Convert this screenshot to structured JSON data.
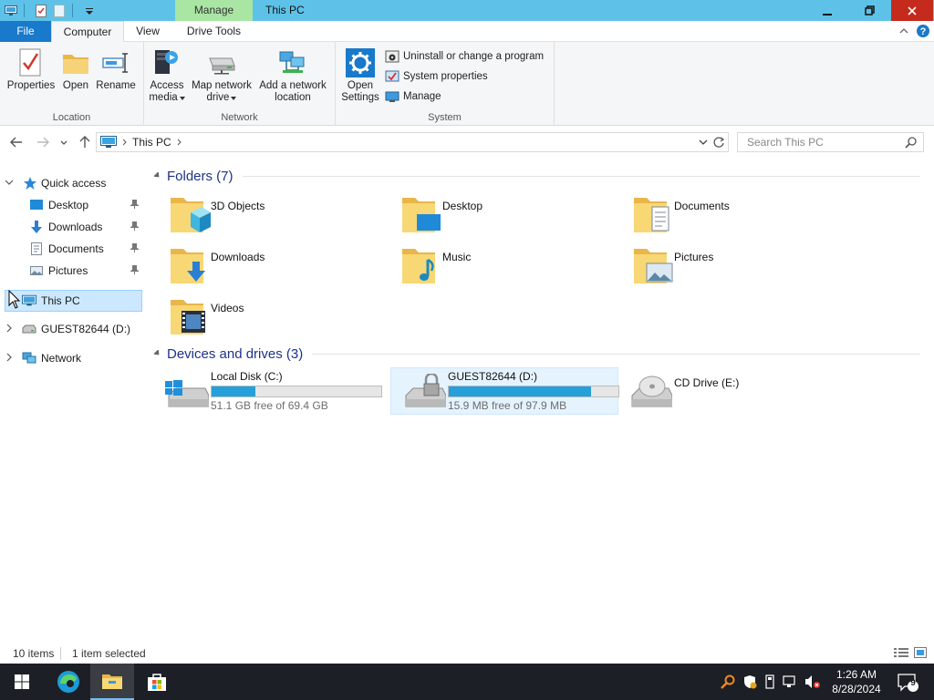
{
  "titlebar": {
    "context_tab": "Manage",
    "title": "This PC"
  },
  "ribbon_tabs": {
    "file": "File",
    "computer": "Computer",
    "view": "View",
    "drive_tools": "Drive Tools"
  },
  "ribbon": {
    "location": {
      "label": "Location",
      "properties": "Properties",
      "open": "Open",
      "rename": "Rename"
    },
    "network": {
      "label": "Network",
      "access_media_1": "Access",
      "access_media_2": "media",
      "map_drive_1": "Map network",
      "map_drive_2": "drive",
      "add_location_1": "Add a network",
      "add_location_2": "location"
    },
    "system": {
      "label": "System",
      "open_settings_1": "Open",
      "open_settings_2": "Settings",
      "uninstall": "Uninstall or change a program",
      "system_properties": "System properties",
      "manage": "Manage"
    }
  },
  "address": {
    "crumb": "This PC",
    "search_placeholder": "Search This PC"
  },
  "nav": {
    "quick_access": "Quick access",
    "desktop": "Desktop",
    "downloads": "Downloads",
    "documents": "Documents",
    "pictures": "Pictures",
    "this_pc": "This PC",
    "guest_drive": "GUEST82644 (D:)",
    "network": "Network"
  },
  "folders_header": "Folders (7)",
  "folders": [
    "3D Objects",
    "Desktop",
    "Documents",
    "Downloads",
    "Music",
    "Pictures",
    "Videos"
  ],
  "drives_header": "Devices and drives (3)",
  "drives": [
    {
      "name": "Local Disk (C:)",
      "free": "51.1 GB free of 69.4 GB",
      "used_fraction": 0.26
    },
    {
      "name": "GUEST82644 (D:)",
      "free": "15.9 MB free of 97.9 MB",
      "used_fraction": 0.84
    },
    {
      "name": "CD Drive (E:)"
    }
  ],
  "status": {
    "items": "10 items",
    "selected": "1 item selected"
  },
  "taskbar": {
    "time": "1:26 AM",
    "date": "8/28/2024",
    "notifications": "9"
  },
  "colors": {
    "titlebar": "#5ec2e8",
    "file_tab": "#1979ca",
    "manage_tab": "#a9e5a3",
    "drive_bar": "#26a0da",
    "selection": "#cce8ff"
  }
}
